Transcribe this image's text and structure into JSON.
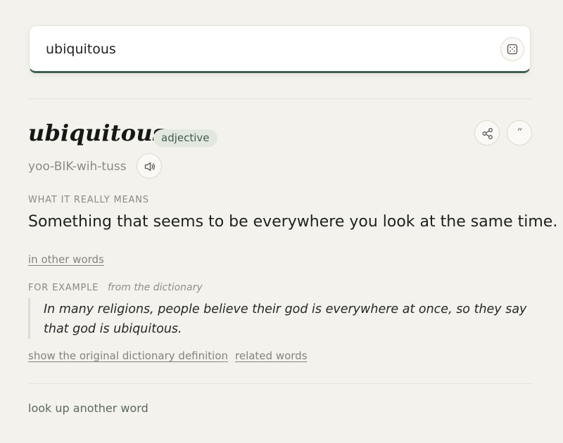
{
  "search": {
    "value": "ubiquitous"
  },
  "entry": {
    "word": "ubiquitous",
    "part_of_speech": "adjective",
    "pronunciation": "yoo-BIK-wih-tuss",
    "meaning_label": "WHAT IT REALLY MEANS",
    "meaning": "Something that seems to be everywhere you look at the same time.",
    "in_other_words_link": "in other words",
    "example_label": "FOR EXAMPLE",
    "example_source": "from the dictionary",
    "example_text": "In many religions, people believe their god is everywhere at once, so they say that god is ubiquitous.",
    "original_definition_link": "show the original dictionary definition",
    "related_words_link": "related words"
  },
  "footer": {
    "lookup_link": "look up another word"
  },
  "icons": {
    "random": "dice-icon",
    "share": "share-icon",
    "quote": "quote-icon",
    "audio": "speaker-icon"
  },
  "colors": {
    "background": "#f4f2ec",
    "accent": "#3f5f50",
    "badge_bg": "#e3e8df",
    "badge_text": "#3f5c4c"
  }
}
